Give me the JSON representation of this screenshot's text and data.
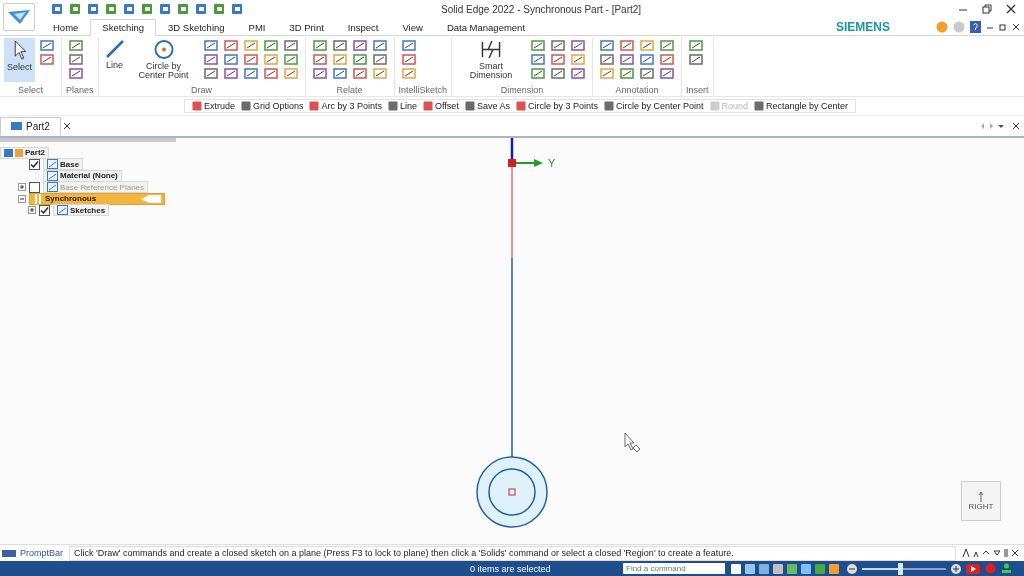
{
  "window": {
    "title": "Solid Edge 2022 - Synchronous Part - [Part2]"
  },
  "tabs": [
    {
      "label": "Home",
      "selected": false
    },
    {
      "label": "Sketching",
      "selected": true
    },
    {
      "label": "3D Sketching",
      "selected": false
    },
    {
      "label": "PMI",
      "selected": false
    },
    {
      "label": "3D Print",
      "selected": false
    },
    {
      "label": "Inspect",
      "selected": false
    },
    {
      "label": "View",
      "selected": false
    },
    {
      "label": "Data Management",
      "selected": false
    }
  ],
  "brand": "SIEMENS",
  "ribbon_groups": [
    {
      "name": "Select",
      "large": [
        {
          "label": "Select",
          "selected": true
        }
      ]
    },
    {
      "name": "Planes"
    },
    {
      "name": "Draw",
      "large": [
        {
          "label": "Line",
          "selected": false
        },
        {
          "label": "Circle by Center Point",
          "selected": false
        }
      ]
    },
    {
      "name": "Relate"
    },
    {
      "name": "IntelliSketch"
    },
    {
      "name": "Dimension",
      "large": [
        {
          "label": "Smart Dimension",
          "selected": false
        }
      ]
    },
    {
      "name": "Annotation"
    },
    {
      "name": "Insert"
    }
  ],
  "command_bar": [
    {
      "label": "Extrude",
      "disabled": false
    },
    {
      "label": "Grid Options",
      "disabled": false
    },
    {
      "label": "Arc by 3 Points",
      "disabled": false
    },
    {
      "label": "Line",
      "disabled": false
    },
    {
      "label": "Offset",
      "disabled": false
    },
    {
      "label": "Save As",
      "disabled": false
    },
    {
      "label": "Circle by 3 Points",
      "disabled": false
    },
    {
      "label": "Circle by Center Point",
      "disabled": false
    },
    {
      "label": "Round",
      "disabled": true
    },
    {
      "label": "Rectangle by Center",
      "disabled": false
    }
  ],
  "document_tabs": [
    {
      "label": "Part2",
      "selected": true
    }
  ],
  "tree": [
    {
      "label": "Part2",
      "kind": "root",
      "children": [
        {
          "label": "Base",
          "kind": "check",
          "checked": true
        },
        {
          "label": "Material (None)",
          "kind": "plain"
        },
        {
          "label": "Base Reference Planes",
          "kind": "check",
          "checked": false,
          "expanded": false,
          "disabled": true
        },
        {
          "label": "Synchronous",
          "kind": "group",
          "selected": true,
          "expanded": true,
          "children": [
            {
              "label": "Sketches",
              "kind": "check",
              "checked": true,
              "expanded": false
            }
          ]
        }
      ]
    }
  ],
  "canvas": {
    "axis_label": "Y",
    "view_cube": "RIGHT"
  },
  "prompt_bar": {
    "label": "PromptBar",
    "message": "Click 'Draw' commands and create a closed sketch on a plane (Press F3 to lock to plane) then click a 'Solids' command or select a closed 'Region' to create a feature."
  },
  "status_bar": {
    "message": "0 items are selected",
    "search": {
      "placeholder": "Find a command"
    },
    "zoom": {
      "level": 0.45
    }
  }
}
